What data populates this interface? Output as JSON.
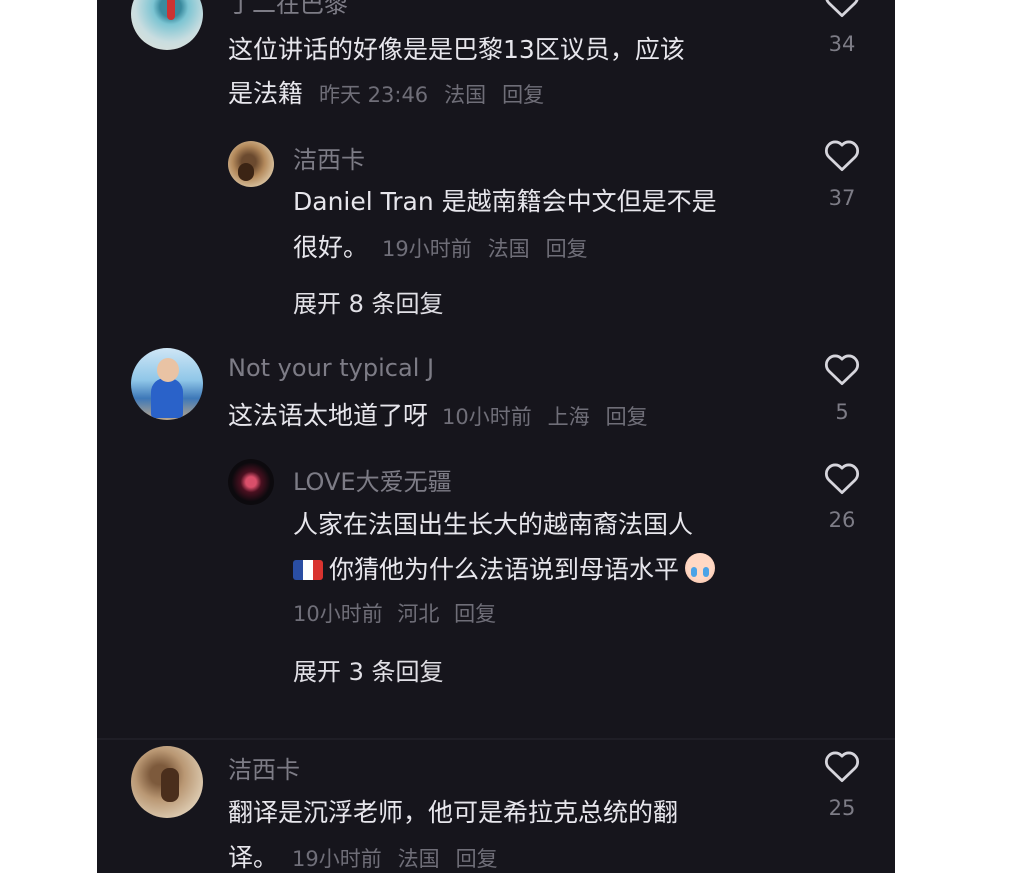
{
  "comments": [
    {
      "username": "丁二在巴黎",
      "text_lines": [
        "这位讲话的好像是是巴黎13区议员，应该",
        "是法籍"
      ],
      "time": "昨天 23:46",
      "location": "法国",
      "reply_label": "回复",
      "likes": "34",
      "reply": {
        "username": "洁西卡",
        "text_lines": [
          "Daniel Tran 是越南籍会中文但是不是",
          "很好。"
        ],
        "time": "19小时前",
        "location": "法国",
        "reply_label": "回复",
        "likes": "37"
      },
      "expand_label": "展开 8 条回复"
    },
    {
      "username": "Not your typical J",
      "text": "这法语太地道了呀",
      "time": "10小时前",
      "location": "上海",
      "reply_label": "回复",
      "likes": "5",
      "reply": {
        "username": "LOVE大爱无疆",
        "text_line1": "人家在法国出生长大的越南裔法国人",
        "text_line2": "你猜他为什么法语说到母语水平",
        "flag_icon": "france-flag",
        "emoji_icon": "crying-face-emoji",
        "time": "10小时前",
        "location": "河北",
        "reply_label": "回复",
        "likes": "26"
      },
      "expand_label": "展开 3 条回复"
    },
    {
      "username": "洁西卡",
      "text_lines": [
        "翻译是沉浮老师，他可是希拉克总统的翻",
        "译。"
      ],
      "time": "19小时前",
      "location": "法国",
      "reply_label": "回复",
      "likes": "25"
    }
  ],
  "colors": {
    "background": "#16151c",
    "username": "#7d7c86",
    "text": "#e7e6ec",
    "meta": "#6f6e78"
  },
  "icons": {
    "like": "heart-outline-icon"
  }
}
